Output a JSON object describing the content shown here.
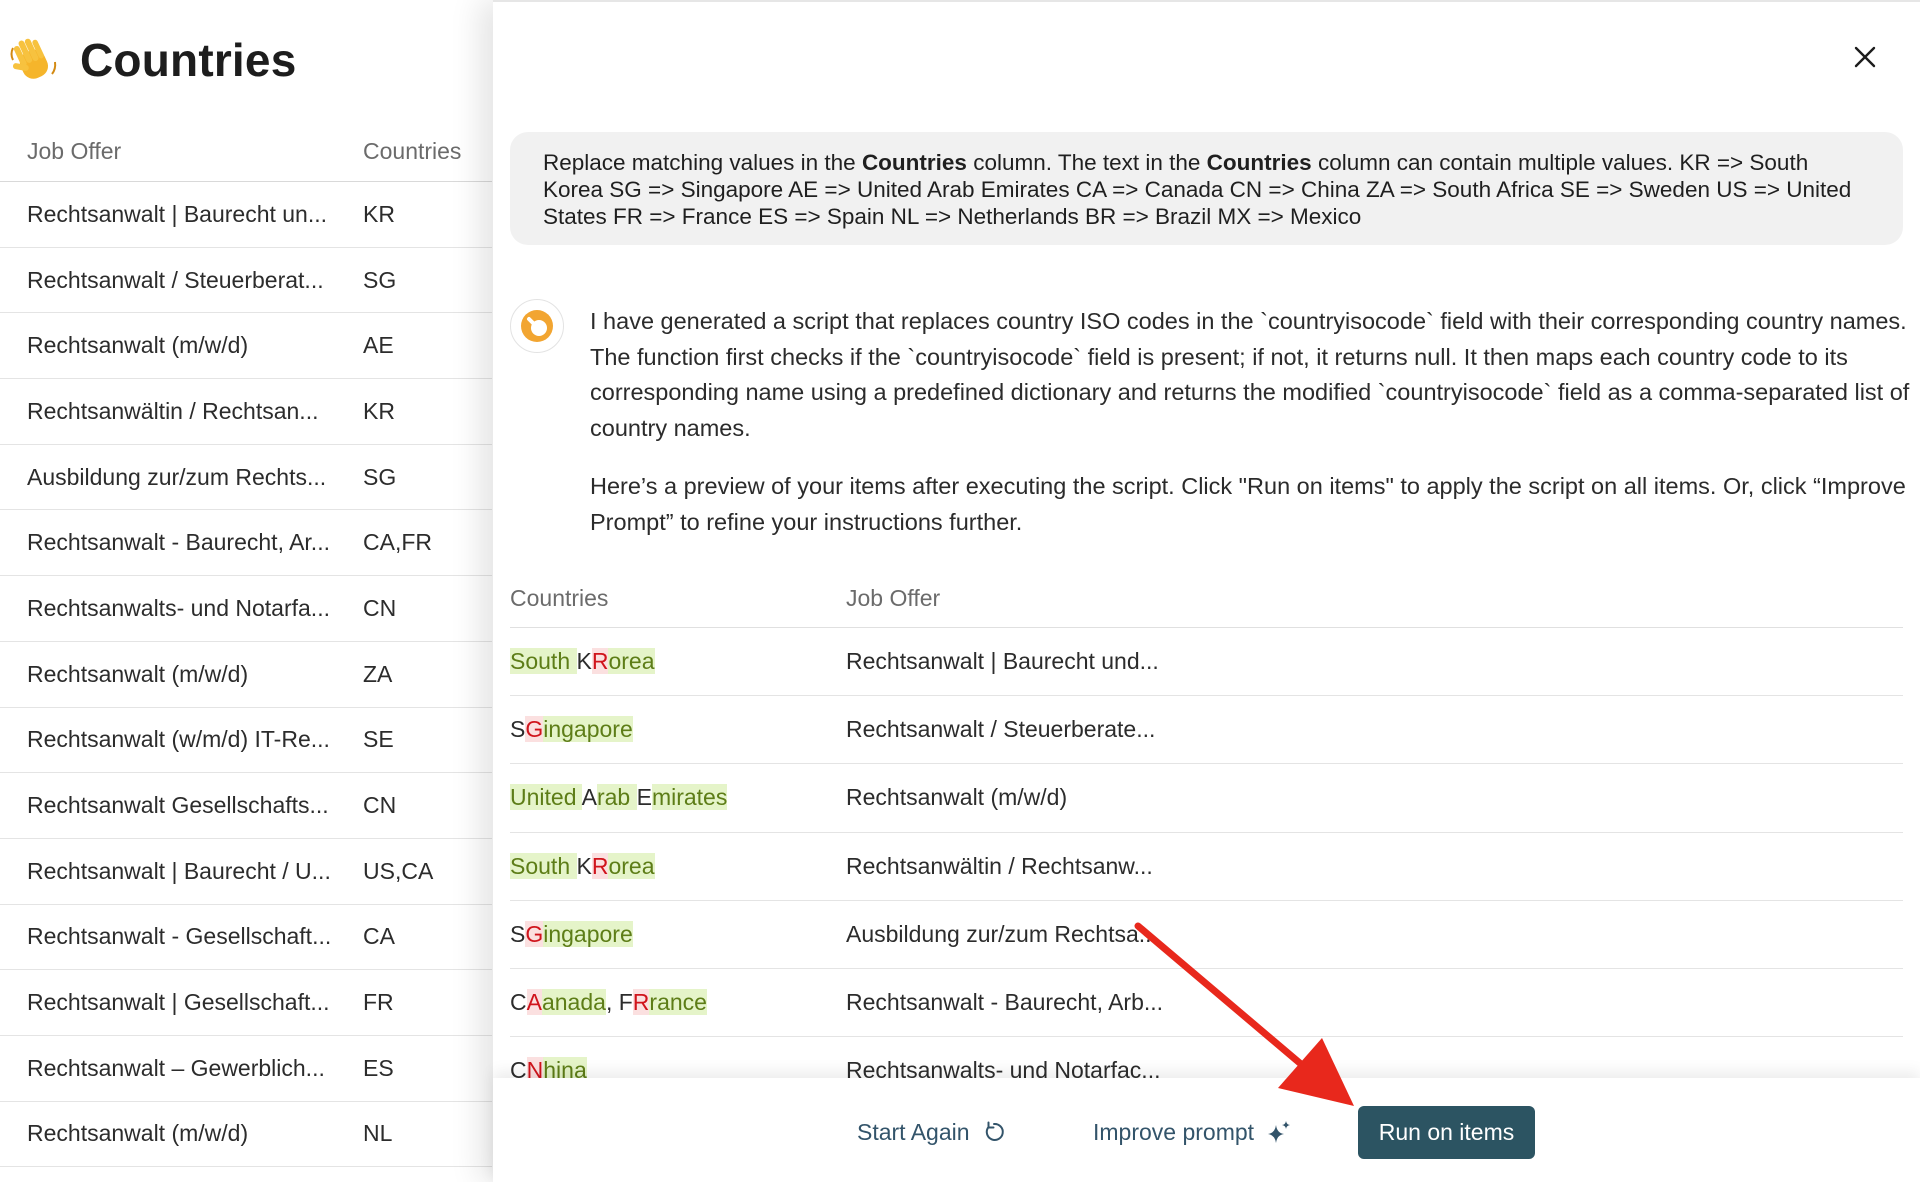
{
  "page": {
    "title": "Countries",
    "wave_icon": "waving-hand-icon"
  },
  "left_table": {
    "headers": [
      "Job Offer",
      "Countries"
    ],
    "rows": [
      [
        "Rechtsanwalt | Baurecht un...",
        "KR"
      ],
      [
        "Rechtsanwalt / Steuerberat...",
        "SG"
      ],
      [
        "Rechtsanwalt (m/w/d)",
        "AE"
      ],
      [
        "Rechtsanwältin / Rechtsan...",
        "KR"
      ],
      [
        "Ausbildung zur/zum Rechts...",
        "SG"
      ],
      [
        "Rechtsanwalt - Baurecht, Ar...",
        "CA,FR"
      ],
      [
        "Rechtsanwalts- und Notarfa...",
        "CN"
      ],
      [
        "Rechtsanwalt (m/w/d)",
        "ZA"
      ],
      [
        "Rechtsanwalt (w/m/d) IT-Re...",
        "SE"
      ],
      [
        "Rechtsanwalt Gesellschafts...",
        "CN"
      ],
      [
        "Rechtsanwalt | Baurecht / U...",
        "US,CA"
      ],
      [
        "Rechtsanwalt - Gesellschaft...",
        "CA"
      ],
      [
        "Rechtsanwalt | Gesellschaft...",
        "FR"
      ],
      [
        "Rechtsanwalt – Gewerblich...",
        "ES"
      ],
      [
        "Rechtsanwalt (m/w/d)",
        "NL"
      ]
    ]
  },
  "modal": {
    "close_icon": "close-icon",
    "prompt": {
      "p1": "Replace matching values in the ",
      "b1": "Countries",
      "p2": " column. The text in the ",
      "b2": "Countries",
      "p3": " column can contain multiple values. KR => South Korea SG => Singapore AE => United Arab Emirates CA => Canada CN => China ZA => South Africa SE => Sweden US => United States FR => France ES => Spain NL => Netherlands BR => Brazil MX => Mexico"
    },
    "assistant": {
      "avatar_icon": "assistant-logo-icon",
      "paragraph1": "I have generated a script that replaces country ISO codes in the `countryisocode` field with their corresponding country names. The function first checks if the `countryisocode` field is present; if not, it returns null. It then maps each country code to its corresponding name using a predefined dictionary and returns the modified `countryisocode` field as a comma-separated list of country names.",
      "paragraph2": "Here’s a preview of your items after executing the script. Click \"Run on items\" to apply the script on all items. Or, click “Improve Prompt” to refine your instructions further."
    },
    "preview": {
      "headers": [
        "Countries",
        "Job Offer"
      ],
      "rows": [
        {
          "segments": [
            [
              "add",
              "South "
            ],
            [
              "keep",
              "K"
            ],
            [
              "del",
              "R"
            ],
            [
              "add",
              "orea"
            ]
          ],
          "job": "Rechtsanwalt | Baurecht und..."
        },
        {
          "segments": [
            [
              "keep",
              "S"
            ],
            [
              "del",
              "G"
            ],
            [
              "add",
              "ingapore"
            ]
          ],
          "job": "Rechtsanwalt / Steuerberate..."
        },
        {
          "segments": [
            [
              "add",
              "United "
            ],
            [
              "keep",
              "A"
            ],
            [
              "add",
              "rab "
            ],
            [
              "keep",
              "E"
            ],
            [
              "add",
              "mirates"
            ]
          ],
          "job": "Rechtsanwalt (m/w/d)"
        },
        {
          "segments": [
            [
              "add",
              "South "
            ],
            [
              "keep",
              "K"
            ],
            [
              "del",
              "R"
            ],
            [
              "add",
              "orea"
            ]
          ],
          "job": "Rechtsanwältin / Rechtsanw..."
        },
        {
          "segments": [
            [
              "keep",
              "S"
            ],
            [
              "del",
              "G"
            ],
            [
              "add",
              "ingapore"
            ]
          ],
          "job": "Ausbildung zur/zum Rechtsa..."
        },
        {
          "segments": [
            [
              "keep",
              "C"
            ],
            [
              "del",
              "A"
            ],
            [
              "add",
              "anada"
            ],
            [
              "keep",
              ", F"
            ],
            [
              "del",
              "R"
            ],
            [
              "add",
              "rance"
            ]
          ],
          "job": "Rechtsanwalt - Baurecht, Arb..."
        },
        {
          "segments": [
            [
              "keep",
              "C"
            ],
            [
              "del",
              "N"
            ],
            [
              "add",
              "hina"
            ]
          ],
          "job": "Rechtsanwalts- und Notarfac..."
        }
      ]
    },
    "footer": {
      "start_again_label": "Start Again",
      "start_again_icon": "refresh-icon",
      "improve_label": "Improve prompt",
      "improve_icon": "sparkle-icon",
      "run_label": "Run on items"
    }
  },
  "colors": {
    "primary_button": "#2c5462",
    "text_button": "#33546a",
    "diff_added_bg": "#e5f4c9",
    "diff_added_text": "#5d7d17",
    "diff_removed_bg": "#fbe0e0",
    "diff_removed_text": "#d0141c",
    "annotation_arrow": "#e8281c"
  }
}
